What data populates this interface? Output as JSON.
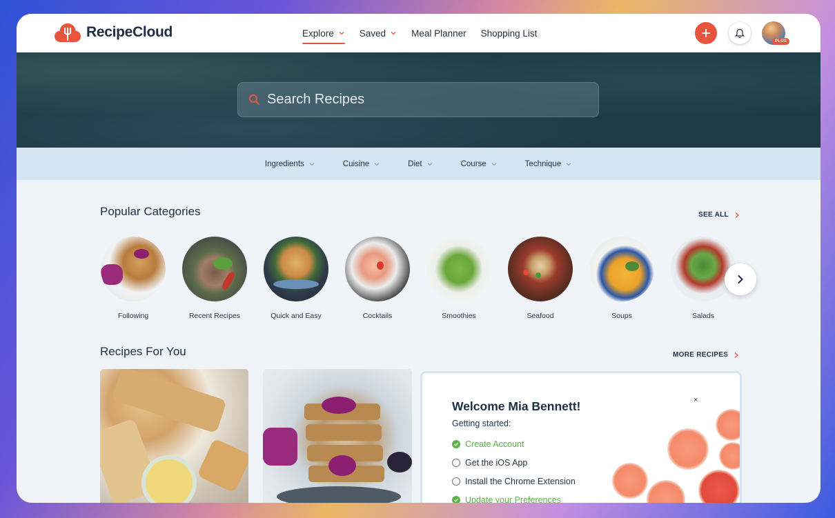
{
  "app": {
    "name": "RecipeCloud"
  },
  "nav": {
    "items": [
      {
        "label": "Explore"
      },
      {
        "label": "Saved"
      },
      {
        "label": "Meal Planner"
      },
      {
        "label": "Shopping List"
      }
    ]
  },
  "user": {
    "badge": "PLUS"
  },
  "search": {
    "placeholder": "Search Recipes"
  },
  "filters": [
    "Ingredients",
    "Cuisine",
    "Diet",
    "Course",
    "Technique"
  ],
  "popular": {
    "title": "Popular Categories",
    "see_all": "SEE ALL",
    "categories": [
      {
        "label": "Following"
      },
      {
        "label": "Recent Recipes"
      },
      {
        "label": "Quick and Easy"
      },
      {
        "label": "Cocktails"
      },
      {
        "label": "Smoothies"
      },
      {
        "label": "Seafood"
      },
      {
        "label": "Soups"
      },
      {
        "label": "Salads"
      }
    ]
  },
  "recipes": {
    "title": "Recipes For You",
    "more": "MORE RECIPES"
  },
  "welcome": {
    "title": "Welcome Mia Bennett!",
    "subtitle": "Getting started:",
    "close": "×",
    "steps": [
      {
        "label": "Create Account",
        "done": true
      },
      {
        "label": "Get the iOS App",
        "done": false
      },
      {
        "label": "Install the Chrome Extension",
        "done": false
      },
      {
        "label": "Update your Preferences",
        "done": true
      }
    ]
  },
  "colors": {
    "accent": "#e8553e",
    "success": "#5db34a",
    "text": "#1d2d44"
  }
}
